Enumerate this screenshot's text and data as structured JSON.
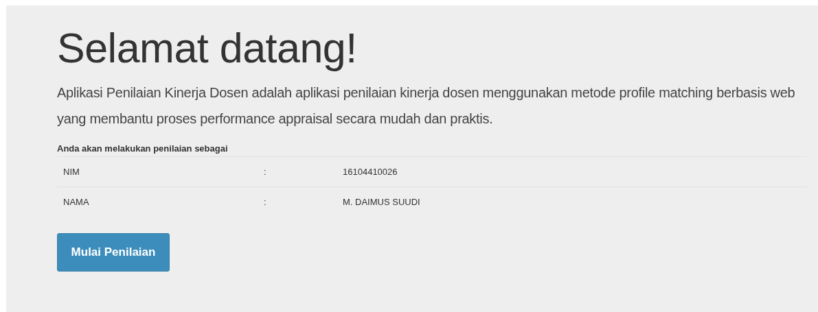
{
  "jumbotron": {
    "heading": "Selamat datang!",
    "lead": "Aplikasi Penilaian Kinerja Dosen adalah aplikasi penilaian kinerja dosen menggunakan metode profile matching berbasis web yang membantu proses performance appraisal secara mudah dan praktis."
  },
  "identity": {
    "caption": "Anda akan melakukan penilaian sebagai",
    "rows": [
      {
        "label": "NIM",
        "separator": ":",
        "value": "16104410026"
      },
      {
        "label": "NAMA",
        "separator": ":",
        "value": "M. DAIMUS SUUDI"
      }
    ]
  },
  "buttons": [
    "Mulai Penilaian"
  ]
}
